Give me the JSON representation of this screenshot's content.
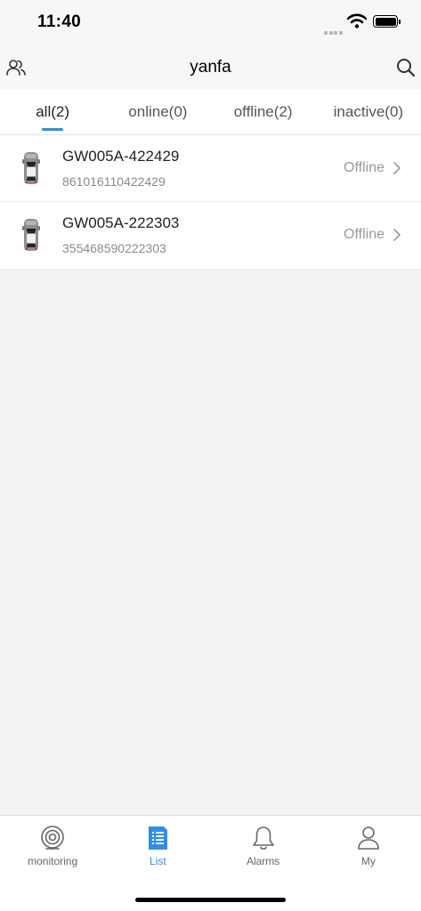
{
  "status_bar": {
    "time": "11:40"
  },
  "nav": {
    "title": "yanfa",
    "left_icon": "user-group-icon",
    "right_icon": "search-icon"
  },
  "tabs": [
    {
      "label": "all(2)",
      "active": true
    },
    {
      "label": "online(0)",
      "active": false
    },
    {
      "label": "offline(2)",
      "active": false
    },
    {
      "label": "inactive(0)",
      "active": false
    }
  ],
  "devices": [
    {
      "name": "GW005A-422429",
      "id": "861016110422429",
      "status": "Offline",
      "icon": "car-icon"
    },
    {
      "name": "GW005A-222303",
      "id": "355468590222303",
      "status": "Offline",
      "icon": "car-icon"
    }
  ],
  "bottom_tabs": [
    {
      "label": "monitoring",
      "icon": "monitoring-icon",
      "active": false
    },
    {
      "label": "List",
      "icon": "list-icon",
      "active": true
    },
    {
      "label": "Alarms",
      "icon": "bell-icon",
      "active": false
    },
    {
      "label": "My",
      "icon": "person-icon",
      "active": false
    }
  ],
  "colors": {
    "accent": "#2f8ee8",
    "background": "#f2f2f2",
    "status_gray": "#9a9a9a"
  }
}
